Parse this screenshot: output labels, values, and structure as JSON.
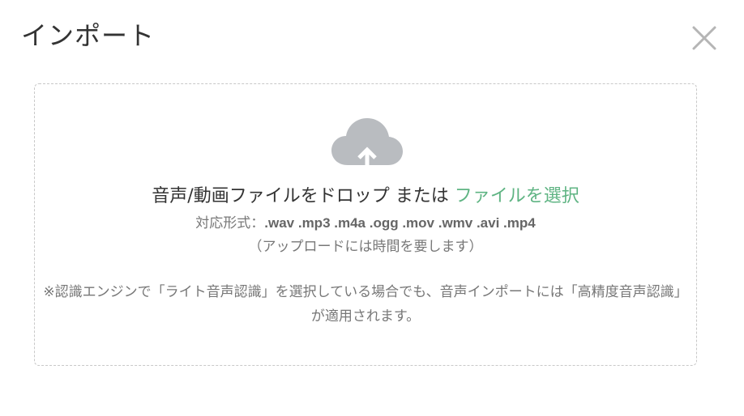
{
  "dialog": {
    "title": "インポート",
    "close_icon": "close-icon"
  },
  "dropzone": {
    "upload_icon": "cloud-upload-icon",
    "drop_text": "音声/動画ファイルをドロップ または ",
    "select_link": "ファイルを選択",
    "formats_label": "対応形式：",
    "formats_list": ".wav .mp3 .m4a .ogg .mov .wmv .avi .mp4",
    "time_note": "（アップロードには時間を要します）",
    "engine_note": "※認識エンジンで「ライト音声認識」を選択している場合でも、音声インポートには「高精度音声認識」が適用されます。"
  },
  "colors": {
    "link": "#5fb483",
    "icon": "#b9bcc0",
    "border": "#c8c8c8"
  }
}
